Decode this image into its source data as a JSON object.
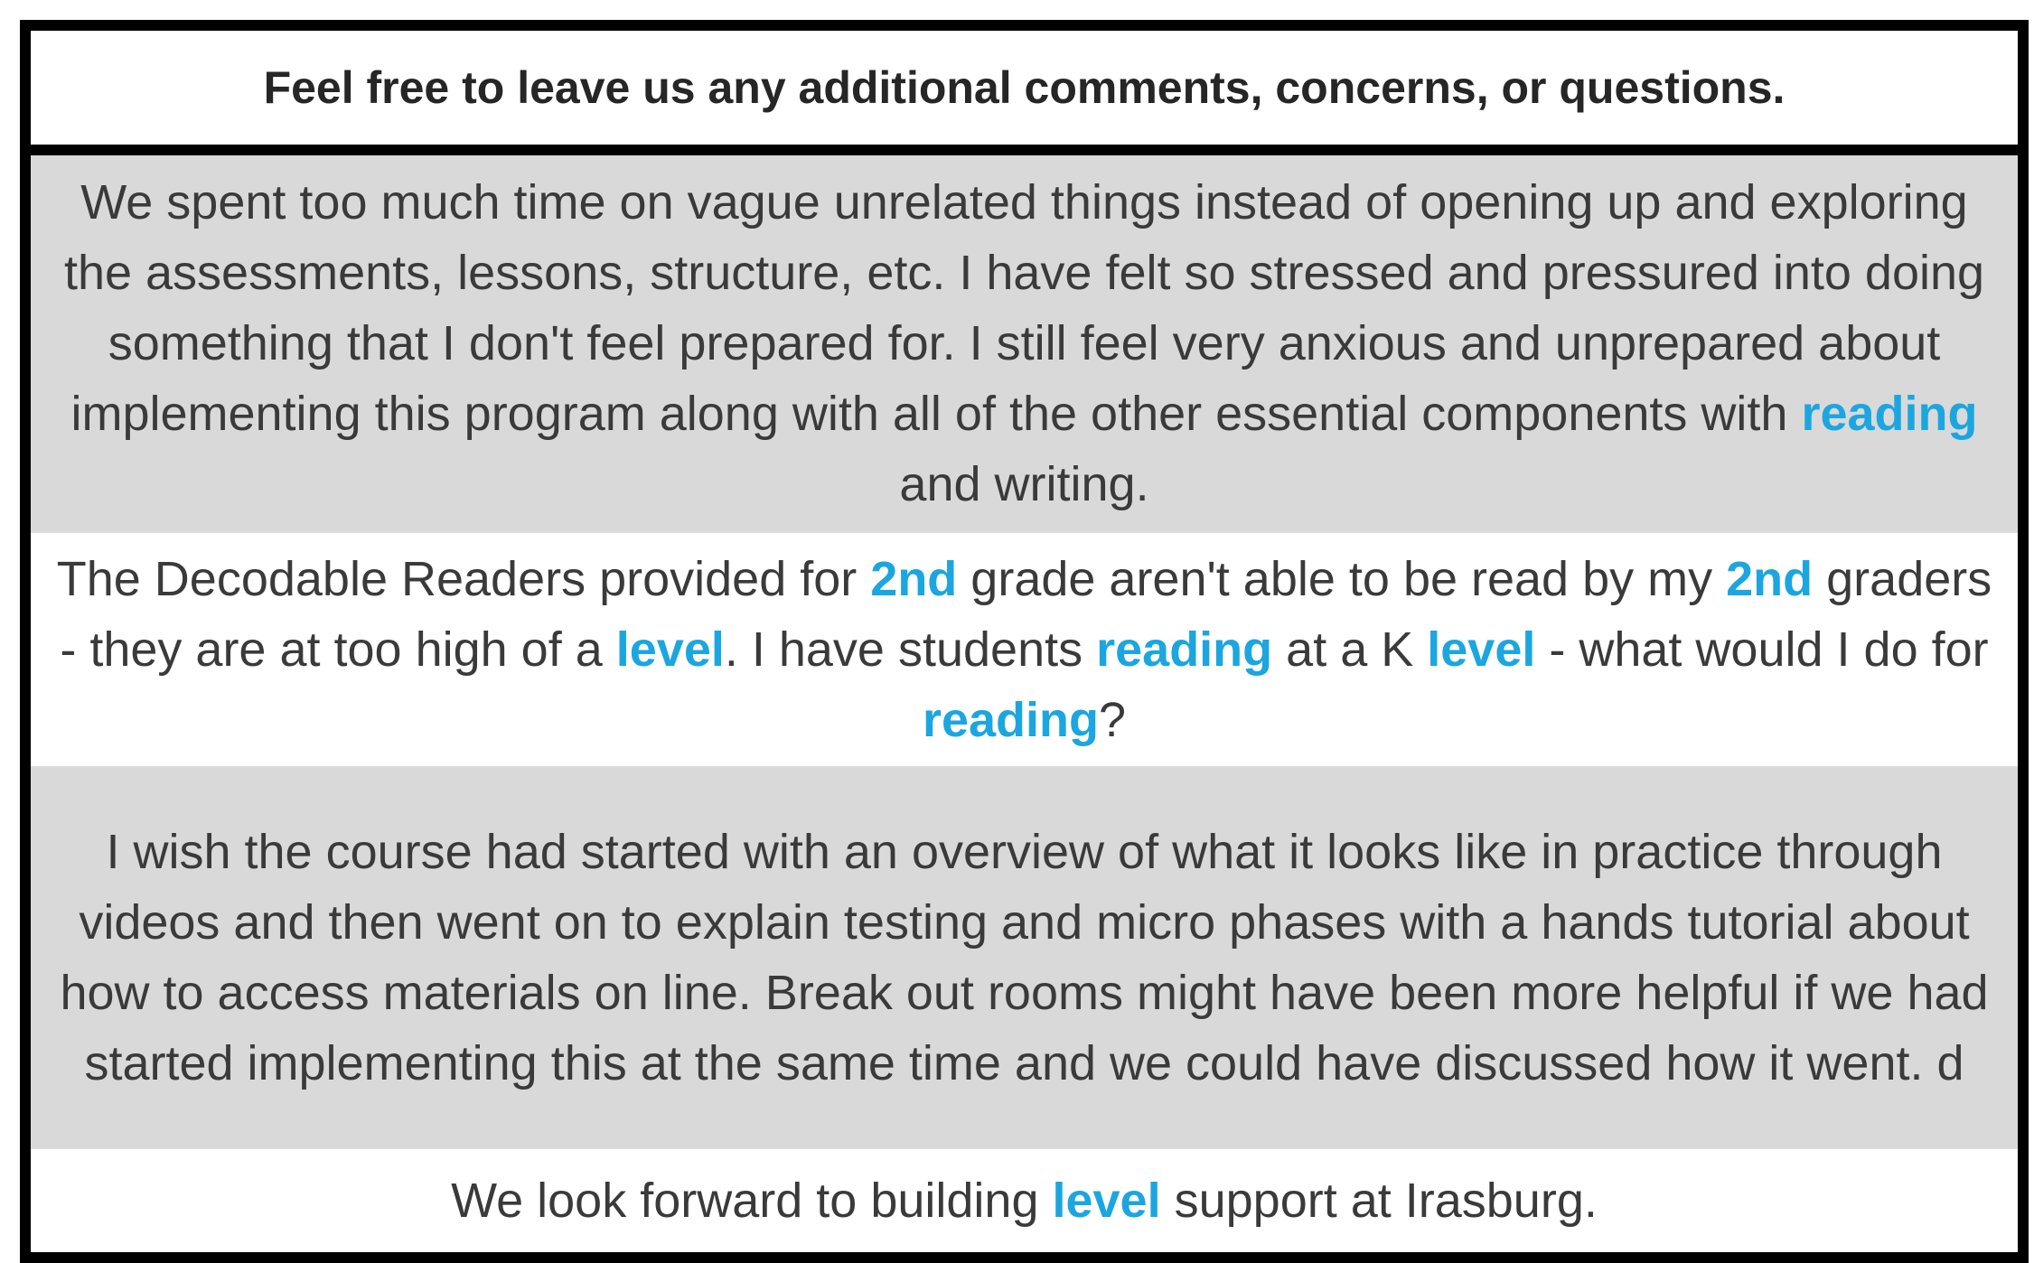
{
  "header": {
    "title": "Feel free to leave us any additional comments, concerns, or questions."
  },
  "colors": {
    "highlight": "#1ba6e0",
    "shaded_row": "#d9d9d9",
    "border": "#000000"
  },
  "comments": [
    {
      "segments": [
        "We spent too much time on vague unrelated things instead of opening up and exploring the assessments, lessons, structure, etc. I have felt so stressed and pressured into doing something that I don't feel prepared for. I still feel very anxious and unprepared about implementing this program along with all of the other essential components with ",
        "reading",
        " and writing."
      ]
    },
    {
      "segments": [
        "The Decodable Readers provided for ",
        "2nd",
        " grade aren't able to be read by my ",
        "2nd",
        " graders - they are at too high of a ",
        "level",
        ". I have students ",
        "reading",
        " at a K ",
        "level",
        " - what would I do for ",
        "reading",
        "?"
      ]
    },
    {
      "segments": [
        "I wish the course had started with an overview of what it looks like in practice through videos and then went on to explain testing and micro phases with a hands tutorial about how to access materials on line. Break out rooms might have been more helpful if we had started implementing this at the same time and we could have discussed how it went. d"
      ]
    },
    {
      "segments": [
        "We look forward to building ",
        "level",
        " support at Irasburg."
      ]
    }
  ]
}
